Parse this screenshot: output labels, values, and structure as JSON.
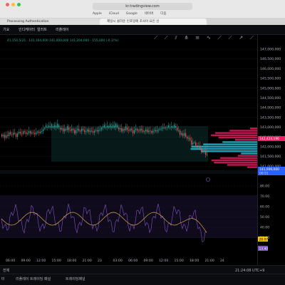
{
  "browser": {
    "url": "kr.tradingview.com",
    "bookmarks": [
      "Apple",
      "iCloud",
      "Google",
      "네이버",
      "다음"
    ],
    "tabs": [
      {
        "label": "Processing Authentication"
      },
      {
        "label": "제일시 클라운 인포밍에 조사이 요인 신"
      }
    ]
  },
  "toolbar": {
    "interval": "기요",
    "indicators": "인디케이터",
    "alert": "얼러트",
    "replay": "리플레이"
  },
  "legend": "41.154.5(21.. 141,164,000 141,000,000 141,204,000 - 155,000 (-0.1!%)",
  "price_axis": {
    "ticks": [
      "147,000,000",
      "146,500,000",
      "146,000,000",
      "145,500,000",
      "145,000,000",
      "144,500,000",
      "144,000,000",
      "143,500,000",
      "143,000,000",
      "142,500,000",
      "142,000,000",
      "141,500,000",
      "141,000,000"
    ],
    "highlight_price": "142,424,196",
    "current_price": "141,006,000",
    "current_time": "00:51"
  },
  "oscillator_axis": {
    "ticks": [
      "80.00",
      "70.00",
      "60.00",
      "50.00",
      "40.00",
      "30.00"
    ],
    "badge_1": "28.07",
    "badge_2": "13.40"
  },
  "time_axis": {
    "ticks": [
      "06:00",
      "09:00",
      "12:00",
      "15:00",
      "18:00",
      "21:00",
      "23",
      "03:00",
      "06:00",
      "09:00",
      "12:00",
      "15:00",
      "18:00",
      "21:00",
      "24"
    ]
  },
  "bottom_bar": {
    "left": "전체",
    "clock": "21:24:08 UTC+9"
  },
  "panel_tabs": [
    "터",
    "리플레이 트레이딩 패널",
    "트레이딩패널"
  ],
  "colors": {
    "up": "#26a69a",
    "down": "#ef5350",
    "rsi_line": "#7e57c2",
    "signal_line": "#d7a94a",
    "volume_up": "#26c6da",
    "volume_down": "#e91e63"
  }
}
